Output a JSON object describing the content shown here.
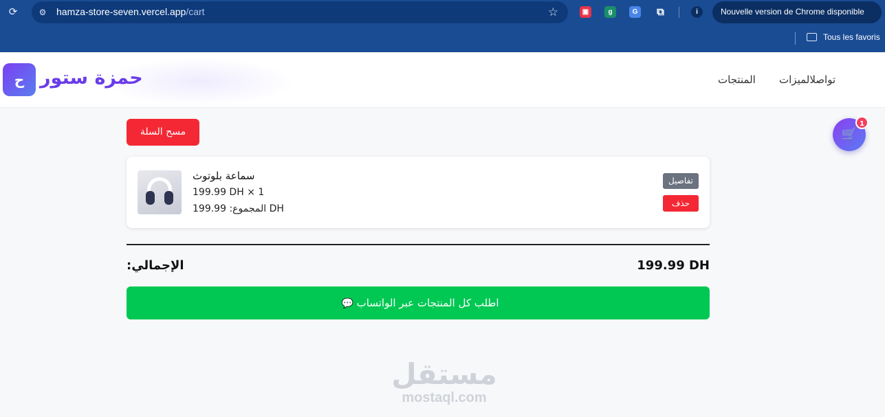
{
  "browser": {
    "url_host": "hamza-store-seven.vercel.app",
    "url_path": "/cart",
    "update_notice": "Nouvelle version de Chrome disponible",
    "bookmark_folder": "Tous les favoris",
    "extensions": [
      "extension-red",
      "extension-green",
      "google-translate-extension",
      "puzzle-extensions",
      "profile-info"
    ]
  },
  "site": {
    "logo_badge": "ح",
    "logo_text": "حمزة ستور",
    "nav": {
      "features_contact": "تواصلالميزات",
      "products": "المنتجات"
    }
  },
  "cart": {
    "clear_label": "مسح السلة",
    "count": "1",
    "items": [
      {
        "name": "سماعة بلوتوث",
        "qty_line": "199.99 DH × 1",
        "subtotal_line": "المجموع: 199.99 DH",
        "details_label": "تفاصيل",
        "delete_label": "حذف"
      }
    ],
    "total_label": "الإجمالي:",
    "total_value": "199.99 DH",
    "whatsapp_label": "اطلب كل المنتجات عبر الواتساب"
  },
  "watermark": {
    "arabic": "مستقل",
    "latin": "mostaql.com"
  },
  "colors": {
    "chrome": "#1a4c94",
    "accent_purple": "#6a3ce8",
    "danger": "#f42834",
    "whatsapp": "#00c853"
  }
}
